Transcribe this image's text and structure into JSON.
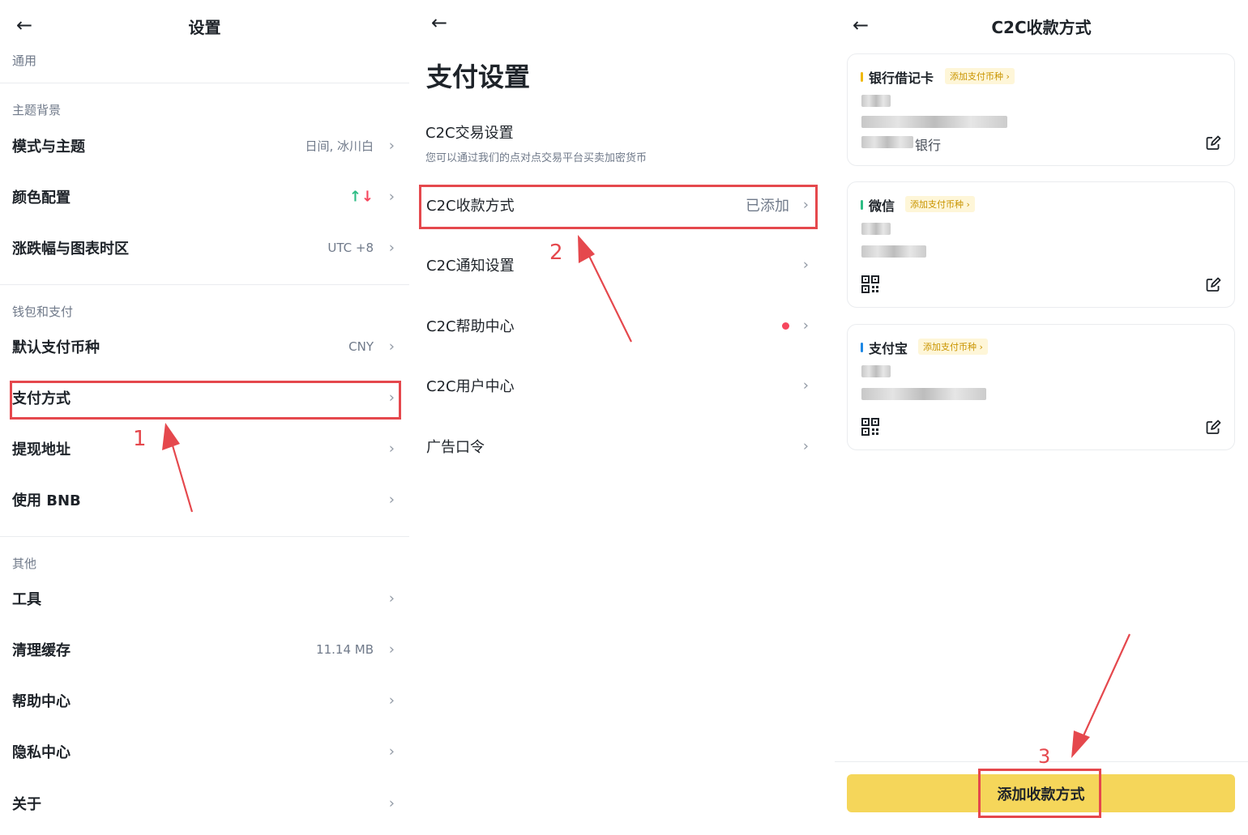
{
  "panel1": {
    "title": "设置",
    "back_icon": "arrow-left-icon",
    "sections": {
      "general": "通用",
      "theme": "主题背景",
      "wallet": "钱包和支付",
      "other": "其他"
    },
    "rows": {
      "mode_theme": {
        "label": "模式与主题",
        "value": "日间, 冰川白"
      },
      "color_config": {
        "label": "颜色配置",
        "value_up": "↑",
        "value_down": "↓"
      },
      "timezone": {
        "label": "涨跌幅与图表时区",
        "value": "UTC +8"
      },
      "default_currency": {
        "label": "默认支付币种",
        "value": "CNY"
      },
      "payment_method": {
        "label": "支付方式"
      },
      "withdraw_address": {
        "label": "提现地址"
      },
      "use_bnb": {
        "label": "使用 BNB"
      },
      "tools": {
        "label": "工具"
      },
      "clear_cache": {
        "label": "清理缓存",
        "value": "11.14 MB"
      },
      "help_center": {
        "label": "帮助中心"
      },
      "privacy_center": {
        "label": "隐私中心"
      },
      "about": {
        "label": "关于"
      }
    }
  },
  "panel2": {
    "title": "支付设置",
    "trade_settings": {
      "label": "C2C交易设置",
      "description": "您可以通过我们的点对点交易平台买卖加密货币"
    },
    "rows": {
      "c2c_receive": {
        "label": "C2C收款方式",
        "value": "已添加"
      },
      "c2c_notify": {
        "label": "C2C通知设置"
      },
      "c2c_help": {
        "label": "C2C帮助中心"
      },
      "c2c_user": {
        "label": "C2C用户中心"
      },
      "ad_code": {
        "label": "广告口令"
      }
    }
  },
  "panel3": {
    "title": "C2C收款方式",
    "cards": {
      "bank": {
        "name": "银行借记卡",
        "tag": "添加支付币种 ›",
        "bank_suffix": "银行",
        "accent": "#f0b90b"
      },
      "wechat": {
        "name": "微信",
        "tag": "添加支付币种 ›",
        "accent": "#2ebd85"
      },
      "alipay": {
        "name": "支付宝",
        "tag": "添加支付币种 ›",
        "accent": "#1e88e5"
      }
    },
    "add_button": "添加收款方式"
  },
  "annotations": {
    "step1": "1",
    "step2": "2",
    "step3": "3",
    "color": "#e5484d"
  },
  "chevron": "›"
}
